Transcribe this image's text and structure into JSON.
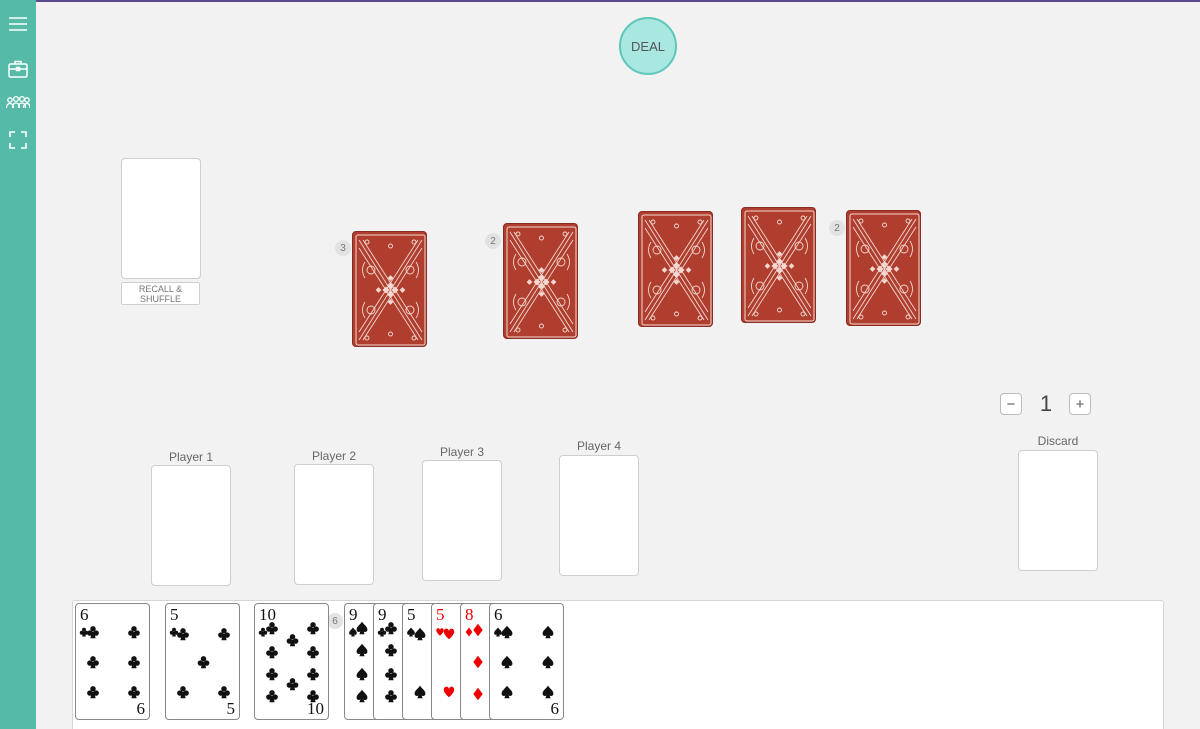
{
  "toolbar": {
    "deal_label": "DEAL",
    "icons": [
      "menu-icon",
      "briefcase-icon",
      "group-icon",
      "fullscreen-icon"
    ]
  },
  "deck": {
    "recall_label_line1": "RECALL &",
    "recall_label_line2": "SHUFFLE"
  },
  "stacks": [
    {
      "badge": "3"
    },
    {
      "badge": "2"
    },
    {
      "badge": ""
    },
    {
      "badge": ""
    },
    {
      "badge": "2"
    }
  ],
  "counter": {
    "minus": "−",
    "value": "1",
    "plus": "+"
  },
  "players": [
    {
      "label": "Player 1"
    },
    {
      "label": "Player 2"
    },
    {
      "label": "Player 3"
    },
    {
      "label": "Player 4"
    }
  ],
  "discard": {
    "label": "Discard"
  },
  "hand": {
    "group_badge": "6",
    "cards": [
      {
        "rank": "6",
        "suit": "clubs"
      },
      {
        "rank": "5",
        "suit": "clubs"
      },
      {
        "rank": "10",
        "suit": "clubs"
      },
      {
        "rank": "9",
        "suit": "spades"
      },
      {
        "rank": "9",
        "suit": "clubs"
      },
      {
        "rank": "5",
        "suit": "spades"
      },
      {
        "rank": "5",
        "suit": "hearts"
      },
      {
        "rank": "8",
        "suit": "diamonds"
      },
      {
        "rank": "6",
        "suit": "spades"
      }
    ]
  },
  "colors": {
    "sidebar": "#55bba8",
    "card_back": "#b03e2e",
    "deal_button": "#a8e8e0"
  }
}
